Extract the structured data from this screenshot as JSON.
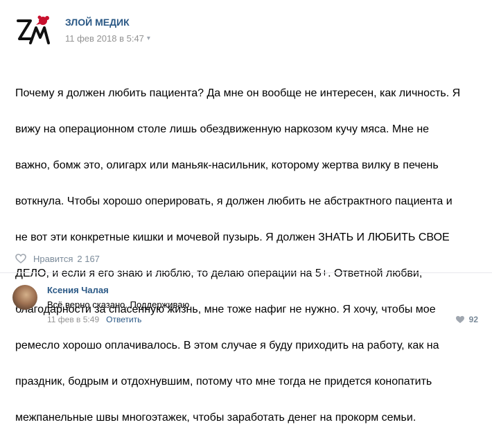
{
  "post": {
    "author": "ЗЛОЙ МЕДИК",
    "date": "11 фев 2018 в 5:47",
    "text_lines": [
      "Почему я должен любить пациента? Да мне он вообще не интересен, как личность. Я",
      "вижу на операционном столе лишь обездвиженную наркозом кучу мяса. Мне не",
      "важно, бомж это, олигарх или маньяк-насильник, которому жертва вилку в печень",
      "воткнула. Чтобы хорошо оперировать, я должен любить не абстрактного пациента и",
      "не вот эти конкретные кишки и мочевой пузырь. Я должен ЗНАТЬ И ЛЮБИТЬ СВОЕ",
      "ДЕЛО, и если я его знаю и люблю, то делаю операции на 5+. Ответной любви,",
      "благодарности за спасенную жизнь, мне тоже нафиг не нужно. Я хочу, чтобы мое",
      "ремесло хорошо оплачивалось. В этом случае я буду приходить на работу, как на",
      "праздник, бодрым и отдохнувшим, потому что мне тогда не придется конопатить",
      "межпанельные швы многоэтажек, чтобы заработать денег на прокорм семьи."
    ],
    "like_label": "Нравится",
    "like_count": "2 167"
  },
  "comment": {
    "author": "Ксения Чалая",
    "text": "Всё верно сказано. Поддерживаю",
    "date": "11 фев в 5:49",
    "reply_label": "Ответить",
    "likes": "92"
  },
  "icons": {
    "logo": "zm-logo-icon",
    "caret": "chevron-down-icon",
    "like": "heart-icon"
  },
  "colors": {
    "link": "#2a5885",
    "meta": "#939393",
    "icon": "#a0a7b0",
    "logo_red": "#c8102e"
  }
}
